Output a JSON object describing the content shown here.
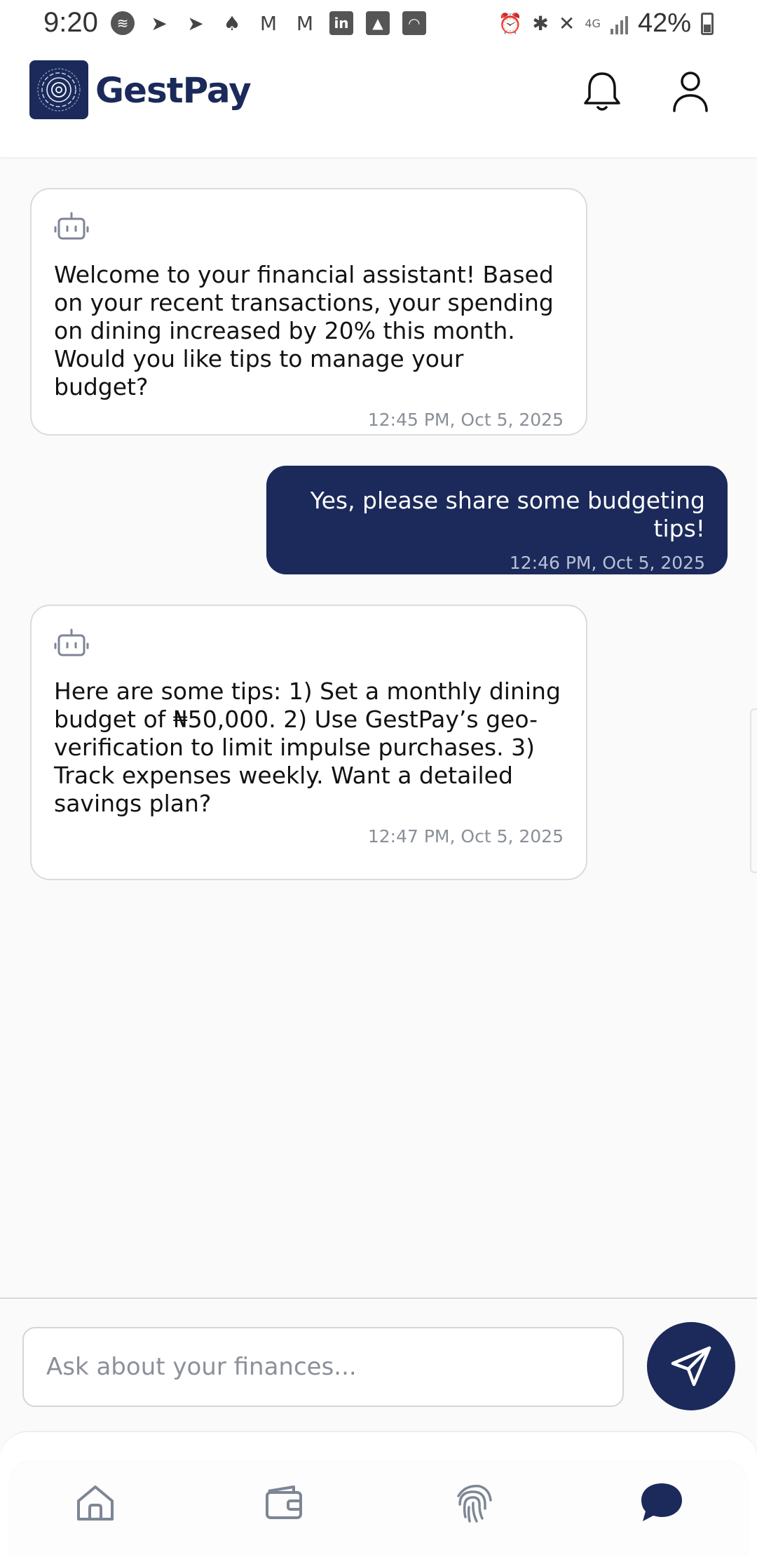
{
  "status_bar": {
    "time": "9:20",
    "network": "4G",
    "battery": "42%"
  },
  "header": {
    "brand": "GestPay",
    "icons": [
      "logo-icon",
      "bell-icon",
      "profile-icon"
    ]
  },
  "messages": [
    {
      "sender": "bot",
      "text": "Welcome to your financial assistant! Based on your recent transactions, your spending on dining increased by 20% this month. Would you like tips to manage your budget?",
      "time": "12:45 PM, Oct 5, 2025"
    },
    {
      "sender": "user",
      "text": "Yes, please share some budgeting tips!",
      "time": "12:46 PM, Oct 5, 2025"
    },
    {
      "sender": "bot",
      "text": "Here are some tips: 1) Set a monthly dining budget of ₦50,000. 2) Use GestPay’s geo-verification to limit impulse purchases. 3) Track expenses weekly. Want a detailed savings plan?",
      "time": "12:47 PM, Oct 5, 2025"
    }
  ],
  "composer": {
    "placeholder": "Ask about your finances...",
    "value": ""
  },
  "bottom_nav": {
    "items": [
      "home-icon",
      "wallet-icon",
      "fingerprint-icon",
      "chat-icon"
    ],
    "active": "chat-icon"
  },
  "colors": {
    "brand": "#1b2a5a",
    "background": "#fafafa",
    "muted": "#8a8f99",
    "nav_inactive": "#7d8694"
  }
}
